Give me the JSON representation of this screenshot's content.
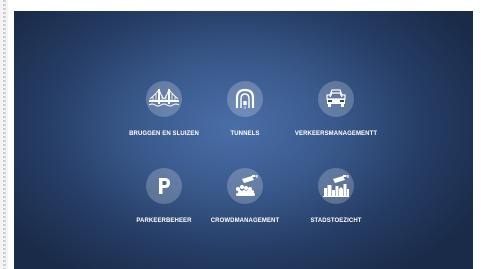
{
  "tiles": [
    {
      "label": "BRUGGEN EN SLUIZEN",
      "icon": "bridge-icon"
    },
    {
      "label": "TUNNELS",
      "icon": "tunnel-icon"
    },
    {
      "label": "VERKEERSMANAGEMENTT",
      "icon": "traffic-cars-icon"
    },
    {
      "label": "PARKEERBEHEER",
      "icon": "parking-icon"
    },
    {
      "label": "CROWDMANAGEMENT",
      "icon": "crowd-camera-icon"
    },
    {
      "label": "STADSTOEZICHT",
      "icon": "city-camera-icon"
    }
  ],
  "colors": {
    "panel_center": "#4a6ea8",
    "panel_edge": "#1a2b49",
    "icon_circle": "rgba(255,255,255,0.22)",
    "text": "#ffffff"
  }
}
